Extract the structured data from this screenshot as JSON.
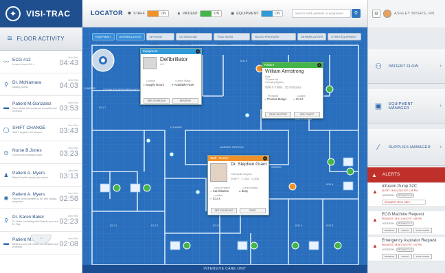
{
  "app": {
    "name": "VISI-TRAC"
  },
  "header": {
    "locator": "LOCATOR",
    "toggles": [
      {
        "label": "STAFF",
        "state": "ON",
        "color": "#f0922a"
      },
      {
        "label": "PATIENT",
        "state": "ON",
        "color": "#44b549"
      },
      {
        "label": "EQUIPMENT",
        "state": "ON",
        "color": "#2f9ad8"
      }
    ],
    "search_placeholder": "Search staff, patients or equipment",
    "user_name": "ASHLEY MYERS, RN"
  },
  "left": {
    "title": "FLOOR ACTIVITY",
    "items": [
      {
        "icon": "ecg-icon",
        "glyph": "〰",
        "title": "ECG #12",
        "sub": "In use in room ICU 4",
        "label": "Next Rnd",
        "time": "04:43"
      },
      {
        "icon": "stethoscope-icon",
        "glyph": "⚲",
        "title": "Dr. McNamara",
        "sub": "Making rounds",
        "label": "Next Rnd",
        "time": "04:03"
      },
      {
        "icon": "bed-icon",
        "glyph": "▬",
        "title": "Patient M.Gonzalez",
        "sub": "Karen Baker lab results are complete and reviewed",
        "label": "Next Rnd",
        "time": "03:53"
      },
      {
        "icon": "clock-icon",
        "glyph": "◯",
        "title": "SHIFT CHANGE",
        "sub": "Shift 2 begins in 15 minutes",
        "label": "Next Rnd",
        "time": "03:43"
      },
      {
        "icon": "stopwatch-icon",
        "glyph": "◷",
        "title": "Nurse B.Jones",
        "sub": "On floor and making rounds",
        "label": "Next Rnd",
        "time": "03:23"
      },
      {
        "icon": "patient-icon",
        "glyph": "♟",
        "title": "Patient A. Myers",
        "sub": "Patient Smith's family has arrived",
        "label": "Next Rnd",
        "time": "03:13"
      },
      {
        "icon": "monitor-icon",
        "glyph": "◉",
        "title": "Patient A. Myers",
        "sub": "Patient Smith admitted to ER with cardiac symptoms",
        "label": "Next Rnd",
        "time": "02:58"
      },
      {
        "icon": "stethoscope-icon",
        "glyph": "⚲",
        "title": "Dr. Karen Baker",
        "sub": "Dr. Baker consulting with Patient Lyons and Dr. Ray",
        "label": "Next Rnd",
        "time": "02:23"
      },
      {
        "icon": "bed-icon",
        "glyph": "▬",
        "title": "Patient M.Lyons",
        "sub": "Melissa Lyons lab results are complete and reviewed",
        "label": "Next Rnd",
        "time": "02:08"
      }
    ]
  },
  "filters": [
    {
      "label": "EQUIPMENT",
      "active": true
    },
    {
      "label": "DEFIBRILLATORS",
      "active": true
    },
    {
      "label": "INFUSION PUMPS",
      "active": false
    },
    {
      "label": "ULTRASOUND MACHINE",
      "active": false
    },
    {
      "label": "VITAL SIGNS MONITORS",
      "active": false
    },
    {
      "label": "BLOOD PRESSURE MONITORS",
      "active": false
    },
    {
      "label": "DEFIBRILLATORS",
      "active": false
    },
    {
      "label": "OTHER EQUIPMENT ▾",
      "active": false
    }
  ],
  "map": {
    "rooms": [
      "CLEAN EQUIP SUPPLY HOLD",
      "CHARGE",
      "ICU 7",
      "ICU 8",
      "ICU 9",
      "ICU 1",
      "ICU 2",
      "ICU 3",
      "ICU 4",
      "ICU 5",
      "ICU 6",
      "LOUNGE",
      "NURSES STATION",
      "SOILED",
      "ANTE ROOM"
    ],
    "footer": "INTENSIVE CARE UNIT"
  },
  "equipment_popup": {
    "header": "Equipment",
    "name": "Defibrillator",
    "id": "#12",
    "loc_label": "Location",
    "loc_value": "Supply Room",
    "status_label": "Current Status",
    "status_value": "Available Now",
    "buttons": [
      "SEE SCHEDULE",
      "RESERVE"
    ]
  },
  "patient_popup": {
    "header": "Patient",
    "name": "William Armstrong",
    "sex": "Male",
    "age": "72 years old",
    "condition": "Coronary Bypass",
    "wait_label": "WAIT-TIME",
    "wait_value": "38 minutes",
    "physician_label": "Physician",
    "physician": "Thomas Marge",
    "location_label": "Location",
    "location": "ICU 8",
    "buttons": [
      "PAGE DOCTOR",
      "SEE CHART"
    ]
  },
  "staff_popup": {
    "header": "Staff - Doctor",
    "name": "Dr. Stephen Grant",
    "role": "Orthopedic Surgeon",
    "shift": "SHIFT : 7:00a - 3:30p",
    "patient_label": "Current Patient",
    "patient": "Carol Barton",
    "status_label": "Current Status",
    "status": "Busy",
    "loc_label": "Location",
    "location": "ICU 3",
    "buttons": [
      "SEE SCHEDULE",
      "PAGE"
    ]
  },
  "right": {
    "buttons": [
      {
        "icon": "patient-flow-icon",
        "glyph": "⚇",
        "label": "PATIENT FLOW"
      },
      {
        "icon": "monitor-icon",
        "glyph": "▣",
        "label": "EQUIPMENT MANAGER"
      },
      {
        "icon": "syringe-icon",
        "glyph": "⁄",
        "label": "SUPPLIES MANAGER"
      }
    ],
    "alerts_title": "ALERTS",
    "alerts": [
      {
        "title": "Infusion Pump 32C",
        "sub": "ALERT: 18:42 | 04/17/07 1:08 PM",
        "loc_label": "LOCATION",
        "loc": "ROOM ICU 5",
        "request": "REQUEST TECH HELP",
        "buttons": []
      },
      {
        "title": "ECG Machine Request",
        "sub": "REQUEST: 18:41 | 04/17/07 1:08 PM",
        "loc_label": "LOCATION",
        "loc": "ROOM ICU 7",
        "request": "",
        "buttons": [
          "RESERVE",
          "ASSIGN",
          "PAGE NURSE"
        ]
      },
      {
        "title": "Emergency Aspirator Request",
        "sub": "REQUEST: 18:36 | 04/17/07 1:02 PM",
        "loc_label": "LOCATION",
        "loc": "ROOM ICU 2",
        "request": "",
        "buttons": [
          "RESERVE",
          "ASSIGN",
          "PAGE NURSE"
        ]
      }
    ]
  }
}
